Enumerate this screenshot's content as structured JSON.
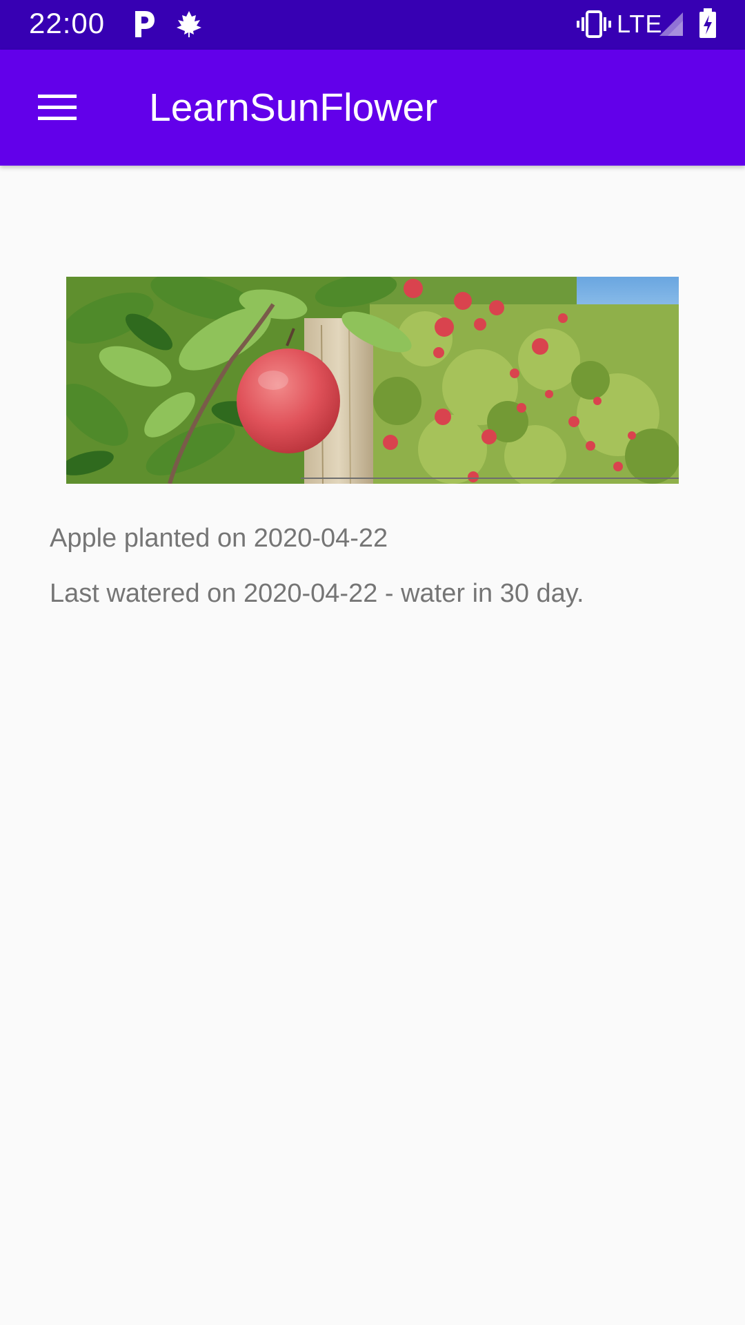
{
  "status_bar": {
    "time": "22:00",
    "network": "LTE",
    "icons": [
      "p-notification-icon",
      "maple-leaf-icon",
      "vibrate-icon",
      "signal-icon",
      "battery-charging-icon"
    ]
  },
  "app_bar": {
    "title": "LearnSunFlower",
    "menu_icon": "hamburger-menu-icon",
    "color": "#6200ea"
  },
  "plant": {
    "image_alt": "apple-orchard-photo",
    "planted_text": "Apple planted on 2020-04-22",
    "watered_text": "Last watered on 2020-04-22 - water in 30 day."
  },
  "colors": {
    "status_bar": "#3700b3",
    "primary": "#6200ea",
    "background": "#fafafa",
    "secondary_text": "#757575"
  }
}
